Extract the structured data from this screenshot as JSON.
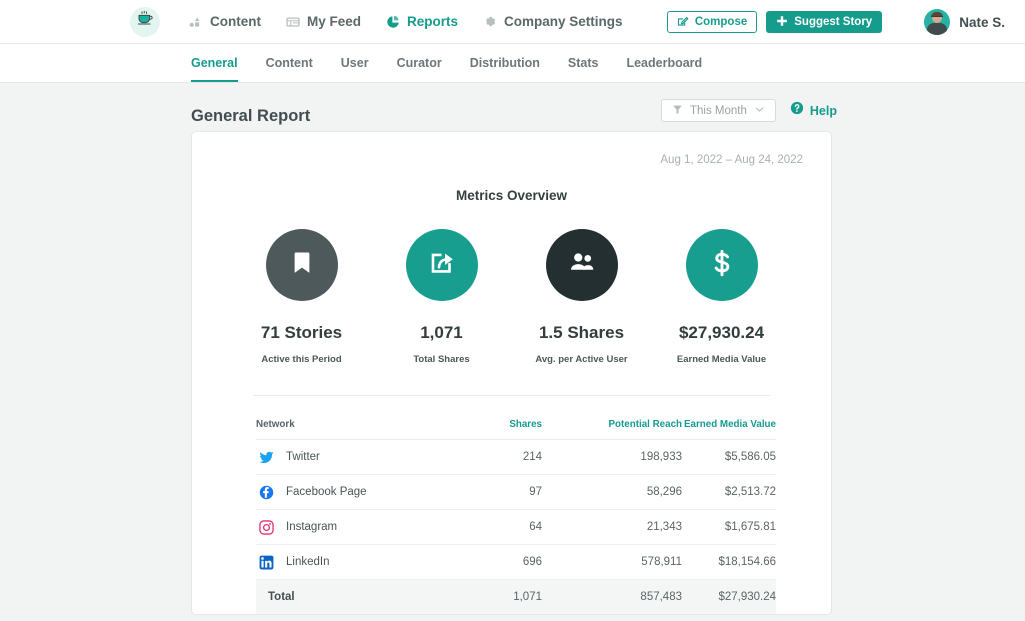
{
  "header": {
    "logo_icon": "coffee-cup-icon",
    "nav": [
      {
        "label": "Content",
        "icon": "content-chart-icon",
        "active": false
      },
      {
        "label": "My Feed",
        "icon": "feed-list-icon",
        "active": false
      },
      {
        "label": "Reports",
        "icon": "pie-chart-icon",
        "active": true
      },
      {
        "label": "Company Settings",
        "icon": "gear-icon",
        "active": false
      }
    ],
    "compose_label": "Compose",
    "compose_icon": "pencil-square-icon",
    "suggest_label": "Suggest Story",
    "suggest_icon": "plus-icon",
    "user_name": "Nate S."
  },
  "subnav": {
    "tabs": [
      {
        "label": "General",
        "active": true
      },
      {
        "label": "Content",
        "active": false
      },
      {
        "label": "User",
        "active": false
      },
      {
        "label": "Curator",
        "active": false
      },
      {
        "label": "Distribution",
        "active": false
      },
      {
        "label": "Stats",
        "active": false
      },
      {
        "label": "Leaderboard",
        "active": false
      }
    ]
  },
  "page": {
    "title": "General Report",
    "filter_label": "This Month",
    "filter_icon": "funnel-icon",
    "filter_chevron": "chevron-down-icon",
    "help_label": "Help",
    "help_icon": "question-circle-icon"
  },
  "report": {
    "date_range": "Aug 1, 2022 – Aug 24, 2022",
    "metrics_title": "Metrics Overview",
    "metrics": [
      {
        "icon": "bookmark-icon",
        "value": "71 Stories",
        "label": "Active this Period",
        "color": "#4d595b"
      },
      {
        "icon": "share-icon",
        "value": "1,071",
        "label": "Total Shares",
        "color": "#179e8e"
      },
      {
        "icon": "users-icon",
        "value": "1.5 Shares",
        "label": "Avg. per Active User",
        "color": "#242f31"
      },
      {
        "icon": "dollar-sign-icon",
        "value": "$27,930.24",
        "label": "Earned Media Value",
        "color": "#179e8e"
      }
    ]
  },
  "table": {
    "columns": [
      "Network",
      "Shares",
      "Potential Reach",
      "Earned Media Value"
    ],
    "rows": [
      {
        "icon": "twitter-icon",
        "network": "Twitter",
        "shares": "214",
        "reach": "198,933",
        "emv": "$5,586.05"
      },
      {
        "icon": "facebook-icon",
        "network": "Facebook Page",
        "shares": "97",
        "reach": "58,296",
        "emv": "$2,513.72"
      },
      {
        "icon": "instagram-icon",
        "network": "Instagram",
        "shares": "64",
        "reach": "21,343",
        "emv": "$1,675.81"
      },
      {
        "icon": "linkedin-icon",
        "network": "LinkedIn",
        "shares": "696",
        "reach": "578,911",
        "emv": "$18,154.66"
      }
    ],
    "total": {
      "network": "Total",
      "shares": "1,071",
      "reach": "857,483",
      "emv": "$27,930.24"
    }
  },
  "colors": {
    "accent": "#169c8c",
    "page_bg": "#f2f3f3",
    "twitter": "#1da1f2",
    "facebook": "#1877f2",
    "instagram": "#e1306c",
    "linkedin": "#0a66c2"
  }
}
